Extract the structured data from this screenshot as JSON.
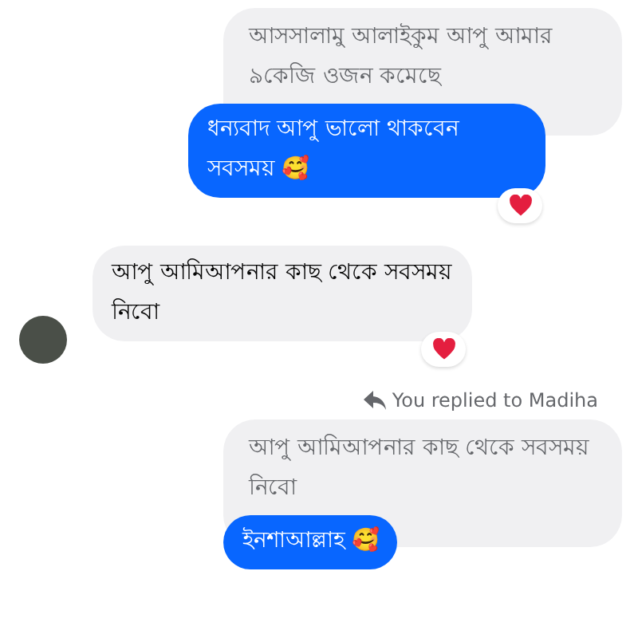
{
  "messages": [
    {
      "kind": "reply",
      "quoted": "আসসালামু আলাইকুম আপু আমার ৯কেজি ওজন কমেছে",
      "text": "ধন্যবাদ আপু ভালো থাকবেন সবসময় 🥰",
      "reacted": true
    },
    {
      "kind": "incoming",
      "text": "আপু আমিআপনার কাছ থেকে সবসময় নিবো",
      "reacted": true
    },
    {
      "kind": "reply",
      "reply_label": "You replied to Madiha",
      "quoted": "আপু আমিআপনার কাছ থেকে সবসময় নিবো",
      "text": "ইনশাআল্লাহ 🥰"
    }
  ]
}
